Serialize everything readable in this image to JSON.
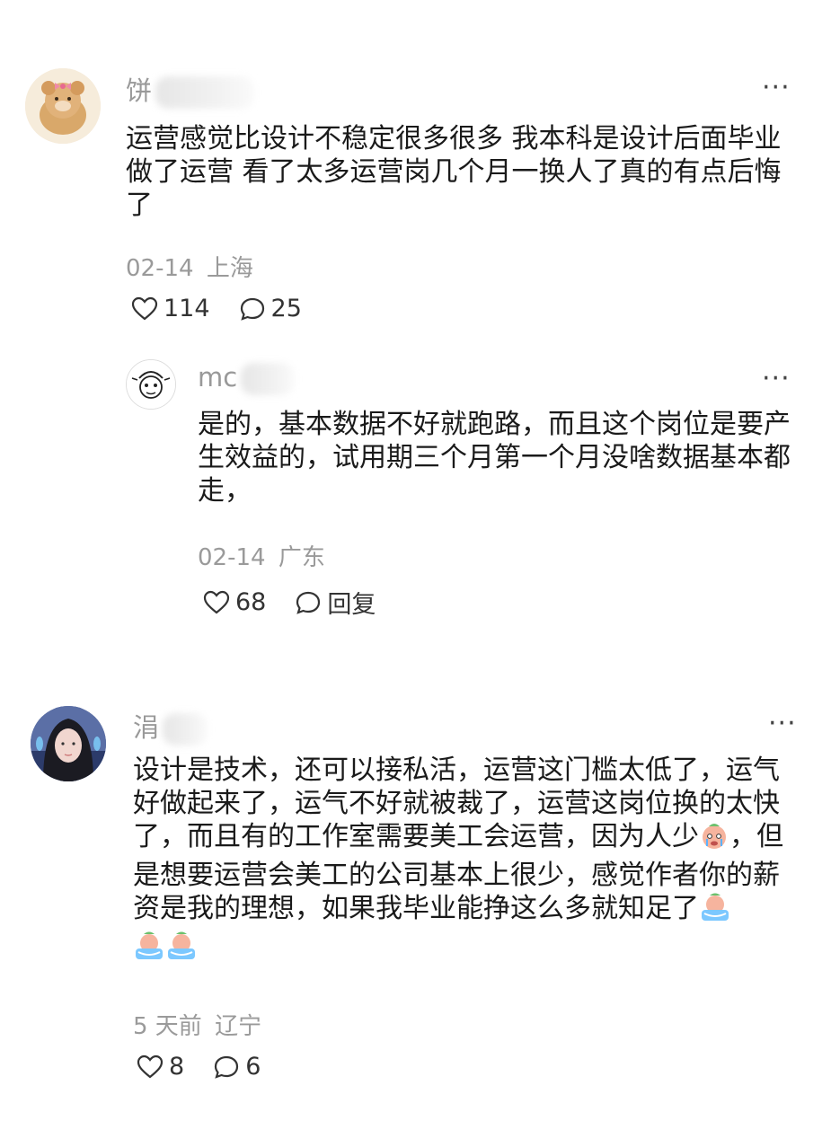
{
  "comments": [
    {
      "username": "饼",
      "text": "运营感觉比设计不稳定很多很多 我本科是设计后面毕业做了运营 看了太多运营岗几个月一换人了真的有点后悔了",
      "date": "02-14",
      "location": "上海",
      "likes": "114",
      "comments": "25",
      "avatar": "bear-with-pink-bow",
      "replies": [
        {
          "username": "mc",
          "text": "是的，基本数据不好就跑路，而且这个岗位是要产生效益的，试用期三个月第一个月没啥数据基本都走，",
          "date": "02-14",
          "location": "广东",
          "likes": "68",
          "reply_label": "回复",
          "avatar": "cartoon-girl-sketch"
        }
      ]
    },
    {
      "username": "涓",
      "text_parts": [
        "设计是技术，还可以接私活，运营这门槛太低了，运气好做起来了，运气不好就被裁了，运营这岗位换的太快了，而且有的工作室需要美工会运营，因为人少",
        "，但是想要运营会美工的公司基本上很少，感觉作者你的薪资是我的理想，如果我毕业能挣这么多就知足了"
      ],
      "date": "5 天前",
      "location": "辽宁",
      "likes": "8",
      "comments": "6",
      "avatar": "woman-portrait"
    }
  ],
  "icons": {
    "more": "more-dots-icon",
    "like": "heart-icon",
    "comment": "comment-bubble-icon",
    "emoji_cry": "crying-face-emoji",
    "emoji_tears": "tears-emoji"
  }
}
